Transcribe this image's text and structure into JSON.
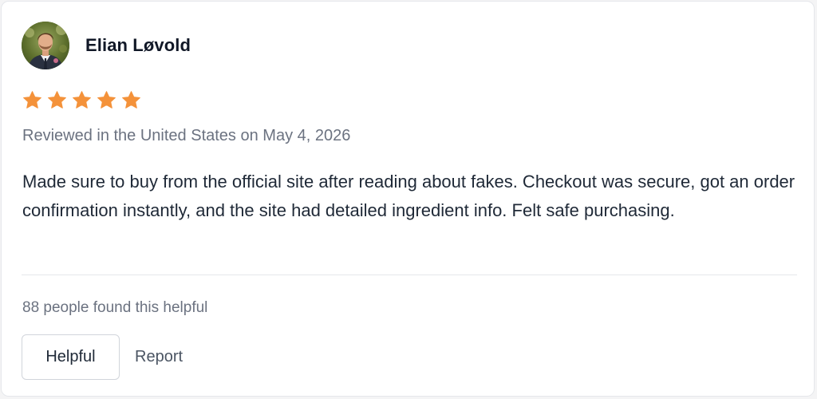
{
  "review": {
    "author": "Elian Løvold",
    "rating": 5,
    "rating_max": 5,
    "star_color": "#f4923a",
    "meta": "Reviewed in the United States on May 4, 2026",
    "text": "Made sure to buy from the official site after reading about fakes. Checkout was secure, got an order confirmation instantly, and the site had detailed ingredient info. Felt safe purchasing.",
    "helpful_count": "88 people found this helpful"
  },
  "actions": {
    "helpful_label": "Helpful",
    "report_label": "Report"
  },
  "icons": {
    "avatar": "user-photo",
    "star": "star-icon"
  }
}
